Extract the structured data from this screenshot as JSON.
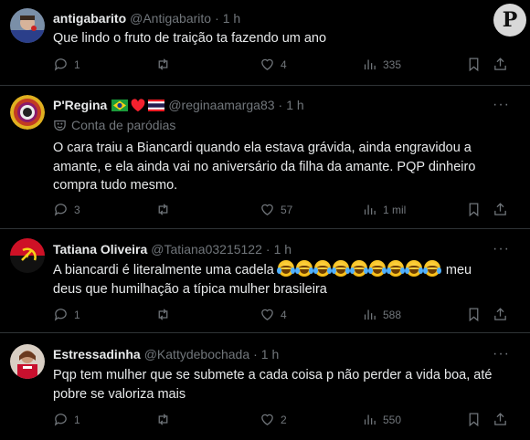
{
  "watermark": "P",
  "tweets": [
    {
      "name": "antigabarito",
      "handle": "@Antigabarito",
      "time": "1 h",
      "text": "Que lindo o fruto de traição ta fazendo um ano",
      "replies": "1",
      "retweets": "",
      "likes": "4",
      "views": "335"
    },
    {
      "name": "P'Regina",
      "handle": "@reginaamarga83",
      "time": "1 h",
      "parody_label": "Conta de paródias",
      "text": "O cara traiu a Biancardi quando ela estava grávida, ainda engravidou a amante, e ela ainda vai no aniversário da filha da amante. PQP dinheiro compra tudo mesmo.",
      "replies": "3",
      "retweets": "",
      "likes": "57",
      "views": "1 mil"
    },
    {
      "name": "Tatiana Oliveira",
      "handle": "@Tatiana03215122",
      "time": "1 h",
      "text_before": "A biancardi é literalmente uma cadela",
      "text_after": " meu deus que humilhação a típica mulher brasileira",
      "emoji_count": 9,
      "replies": "1",
      "retweets": "",
      "likes": "4",
      "views": "588"
    },
    {
      "name": "Estressadinha",
      "handle": "@Kattydebochada",
      "time": "1 h",
      "text": "Pqp tem mulher que se submete a cada coisa p não perder a vida boa, até pobre se valoriza mais",
      "replies": "1",
      "retweets": "",
      "likes": "2",
      "views": "550"
    }
  ],
  "dot": "·",
  "more_icon": "···"
}
